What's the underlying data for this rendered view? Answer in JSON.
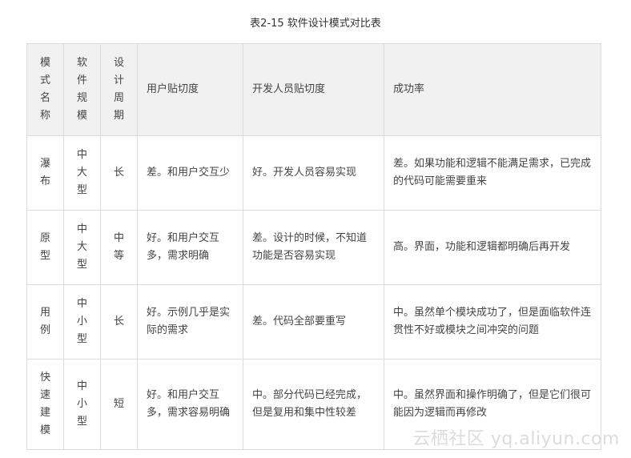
{
  "caption": "表2-15 软件设计模式对比表",
  "table": {
    "headers": [
      "模式名称",
      "软件规模",
      "设计周期",
      "用户贴切度",
      "开发人员贴切度",
      "成功率"
    ],
    "rows": [
      [
        "瀑布",
        "中大型",
        "长",
        "差。和用户交互少",
        "好。开发人员容易实现",
        "差。如果功能和逻辑不能满足需求，已完成的代码可能需要重来"
      ],
      [
        "原型",
        "中大型",
        "中等",
        "好。和用户交互多，需求明确",
        "差。设计的时候，不知道功能是否容易实现",
        "高。界面，功能和逻辑都明确后再开发"
      ],
      [
        "用例",
        "中小型",
        "长",
        "好。示例几乎是实际的需求",
        "差。代码全部要重写",
        "中。虽然单个模块成功了，但是面临软件连贯性不好或模块之间冲突的问题"
      ],
      [
        "快速建模",
        "中小型",
        "短",
        "好。和用户交互多，需求容易明确",
        "中。部分代码已经完成，但是复用和集中性较差",
        "中。虽然界面和操作明确了，但是它们很可能因为逻辑而再修改"
      ]
    ]
  },
  "watermark": "云栖社区 yq.aliyun.com"
}
